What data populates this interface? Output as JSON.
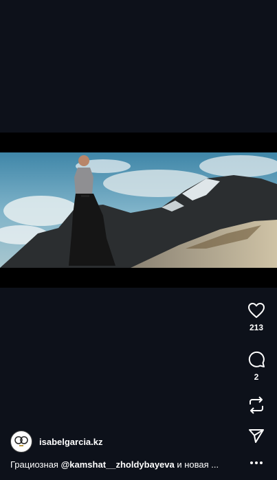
{
  "post": {
    "username": "isabelgarcia.kz",
    "caption_prefix": "Грациозная ",
    "caption_mention": "@kamshat__zholdybayeva",
    "caption_suffix": " и новая ...",
    "likes": "213",
    "comments": "2"
  },
  "icons": {
    "like": "heart-icon",
    "comment": "comment-icon",
    "repost": "repost-icon",
    "share": "send-icon",
    "more": "more-icon"
  },
  "colors": {
    "background": "#0d111a",
    "text": "#ffffff"
  }
}
